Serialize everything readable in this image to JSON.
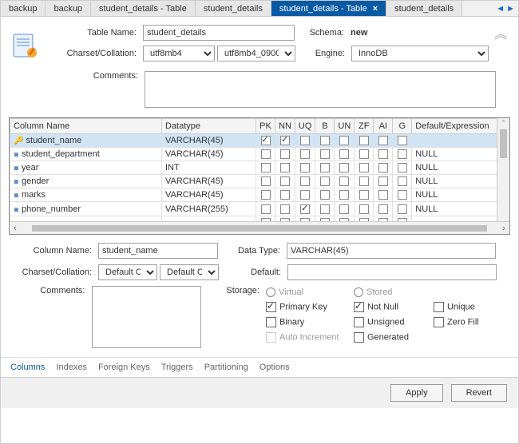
{
  "tabs": [
    {
      "label": "backup"
    },
    {
      "label": "backup"
    },
    {
      "label": "student_details - Table"
    },
    {
      "label": "student_details"
    },
    {
      "label": "student_details - Table",
      "active": true,
      "closable": true
    },
    {
      "label": "student_details"
    }
  ],
  "form": {
    "table_name_label": "Table Name:",
    "table_name": "student_details",
    "schema_label": "Schema:",
    "schema": "new",
    "charset_label": "Charset/Collation:",
    "charset": "utf8mb4",
    "collation": "utf8mb4_0900",
    "engine_label": "Engine:",
    "engine": "InnoDB",
    "comments_label": "Comments:",
    "comments": ""
  },
  "grid": {
    "headers": [
      "Column Name",
      "Datatype",
      "PK",
      "NN",
      "UQ",
      "B",
      "UN",
      "ZF",
      "AI",
      "G",
      "Default/Expression"
    ],
    "rows": [
      {
        "icon": "key",
        "name": "student_name",
        "type": "VARCHAR(45)",
        "flags": [
          true,
          true,
          false,
          false,
          false,
          false,
          false,
          false
        ],
        "def": "",
        "sel": true
      },
      {
        "icon": "dia",
        "name": "student_department",
        "type": "VARCHAR(45)",
        "flags": [
          false,
          false,
          false,
          false,
          false,
          false,
          false,
          false
        ],
        "def": "NULL"
      },
      {
        "icon": "dia",
        "name": "year",
        "type": "INT",
        "flags": [
          false,
          false,
          false,
          false,
          false,
          false,
          false,
          false
        ],
        "def": "NULL"
      },
      {
        "icon": "dia",
        "name": "gender",
        "type": "VARCHAR(45)",
        "flags": [
          false,
          false,
          false,
          false,
          false,
          false,
          false,
          false
        ],
        "def": "NULL"
      },
      {
        "icon": "dia",
        "name": "marks",
        "type": "VARCHAR(45)",
        "flags": [
          false,
          false,
          false,
          false,
          false,
          false,
          false,
          false
        ],
        "def": "NULL"
      },
      {
        "icon": "dia",
        "name": "phone_number",
        "type": "VARCHAR(255)",
        "flags": [
          false,
          false,
          true,
          false,
          false,
          false,
          false,
          false
        ],
        "def": "NULL"
      },
      {
        "icon": "",
        "name": "",
        "type": "",
        "flags": [
          false,
          false,
          false,
          false,
          false,
          false,
          false,
          false
        ],
        "def": ""
      }
    ]
  },
  "det": {
    "col_name_label": "Column Name:",
    "col_name": "student_name",
    "datatype_label": "Data Type:",
    "datatype": "VARCHAR(45)",
    "charset_label": "Charset/Collation:",
    "charset": "Default C",
    "collation": "Default C",
    "default_label": "Default:",
    "default": "",
    "comments_label": "Comments:",
    "comments": "",
    "storage_label": "Storage:",
    "virtual": "Virtual",
    "stored": "Stored",
    "pk": "Primary Key",
    "nn": "Not Null",
    "uq": "Unique",
    "bin": "Binary",
    "un": "Unsigned",
    "zf": "Zero Fill",
    "ai": "Auto Increment",
    "gen": "Generated",
    "pk_on": true,
    "nn_on": true,
    "uq_on": false,
    "bin_on": false,
    "un_on": false,
    "zf_on": false,
    "ai_on": false,
    "gen_on": false
  },
  "bottom_tabs": [
    "Columns",
    "Indexes",
    "Foreign Keys",
    "Triggers",
    "Partitioning",
    "Options"
  ],
  "bottom_active": 0,
  "footer": {
    "apply": "Apply",
    "revert": "Revert"
  }
}
